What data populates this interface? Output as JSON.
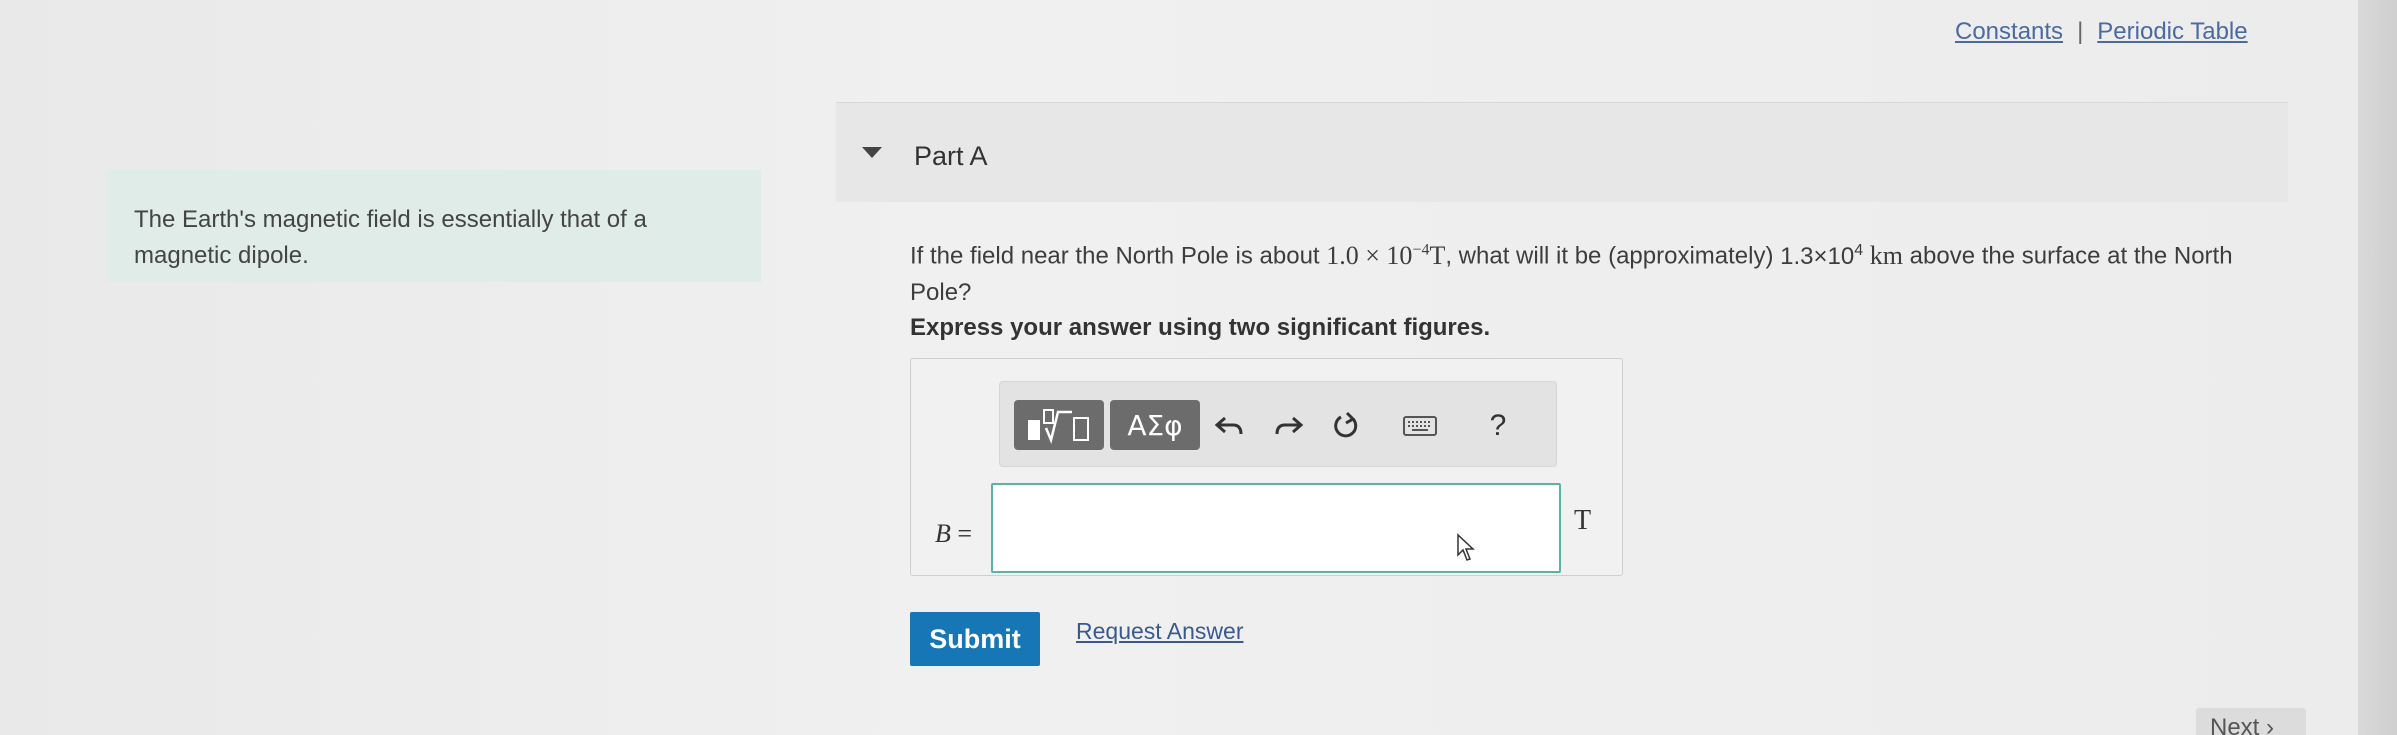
{
  "header": {
    "links": [
      "Constants",
      "Periodic Table"
    ],
    "separator": "|"
  },
  "intro": {
    "text": "The Earth's magnetic field is essentially that of a magnetic dipole."
  },
  "part": {
    "title": "Part A",
    "question": {
      "prefix": "If the field near the North Pole is about ",
      "field_coeff": "1.0 × 10",
      "field_exp": "−4",
      "field_unit": "T",
      "middle": ", what will it be (approximately) ",
      "height_coeff": "1.3×10",
      "height_exp": "4",
      "height_unit": "km",
      "suffix": " above the surface at the North Pole?"
    },
    "instruction": "Express your answer using two significant figures."
  },
  "answer": {
    "toolbar": {
      "templates_icon": "templates-icon",
      "greek_label": "ΑΣφ",
      "help_label": "?"
    },
    "variable": "B",
    "equals": " =",
    "input_value": "",
    "unit": "T"
  },
  "actions": {
    "submit_label": "Submit",
    "request_answer_label": "Request Answer",
    "next_label": "Next ›"
  },
  "colors": {
    "intro_bg": "#dfece8",
    "submit_bg": "#1676b6",
    "input_border": "#5fb1a3",
    "link": "#3a5a8f"
  }
}
